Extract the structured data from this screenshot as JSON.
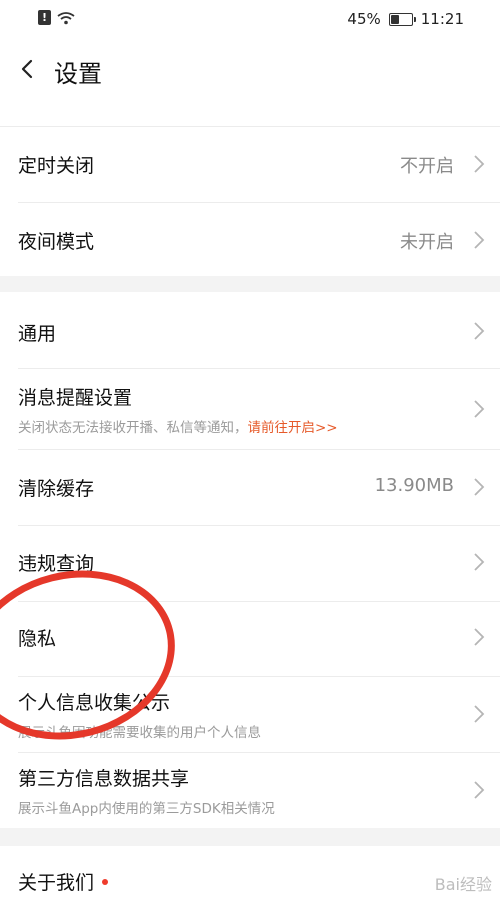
{
  "status_bar": {
    "battery": "45%",
    "time": "11:21",
    "battery_level": 0.45
  },
  "header": {
    "title": "设置"
  },
  "group1": [
    {
      "label": "定时关闭",
      "value": "不开启"
    },
    {
      "label": "夜间模式",
      "value": "未开启"
    }
  ],
  "group2": {
    "general": {
      "label": "通用"
    },
    "notification": {
      "label": "消息提醒设置",
      "desc": "关闭状态无法接收开播、私信等通知，",
      "link": "请前往开启>>"
    },
    "cache": {
      "label": "清除缓存",
      "value": "13.90MB"
    },
    "violation": {
      "label": "违规查询"
    },
    "privacy": {
      "label": "隐私"
    },
    "info_collect": {
      "label": "个人信息收集公示",
      "desc": "展示斗鱼因功能需要收集的用户个人信息"
    },
    "third_party": {
      "label": "第三方信息数据共享",
      "desc": "展示斗鱼App内使用的第三方SDK相关情况"
    }
  },
  "group3": {
    "about": {
      "label": "关于我们"
    }
  },
  "watermark": "Bai经验"
}
